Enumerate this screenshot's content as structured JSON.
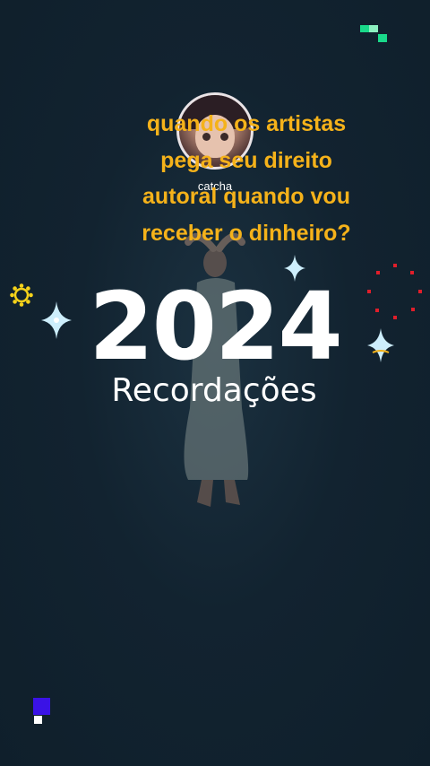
{
  "video": {
    "username": "catcha",
    "caption_lines": [
      "quando os artistas",
      "pega seu direito",
      "autoral quando vou",
      "receber o dinheiro?"
    ],
    "year": "2024",
    "subtitle": "Recordações"
  },
  "colors": {
    "background": "#10212e",
    "caption": "#f5b21a",
    "headline": "#ffffff",
    "gear": "#f5d21a",
    "dots": "#e01e2a",
    "corner_top_right": "#19d98a",
    "corner_bottom_left": "#3a12e6"
  },
  "icons": {
    "decor": [
      "sparkle-icon",
      "gear-icon",
      "red-dot-ring-icon",
      "corner-pixel-icon"
    ]
  }
}
